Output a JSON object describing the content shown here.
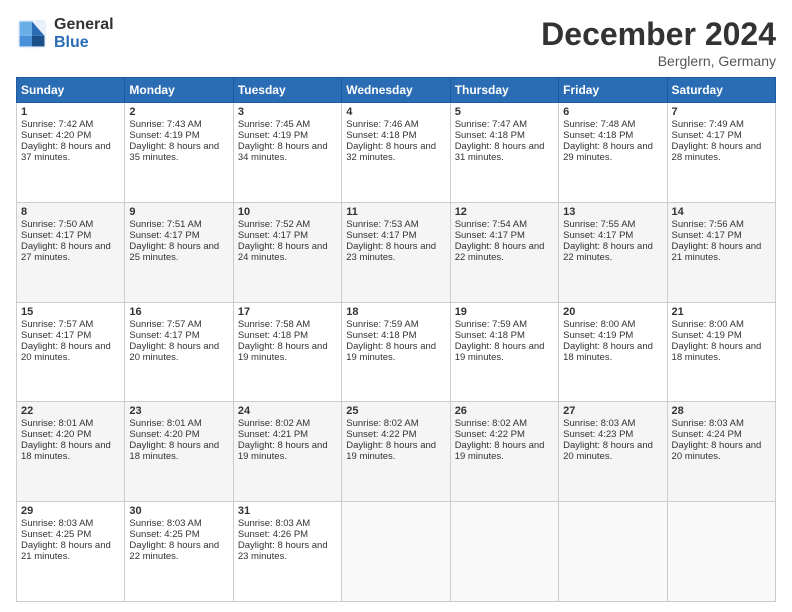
{
  "logo": {
    "general": "General",
    "blue": "Blue"
  },
  "header": {
    "month": "December 2024",
    "location": "Berglern, Germany"
  },
  "weekdays": [
    "Sunday",
    "Monday",
    "Tuesday",
    "Wednesday",
    "Thursday",
    "Friday",
    "Saturday"
  ],
  "weeks": [
    [
      {
        "day": "1",
        "sunrise": "Sunrise: 7:42 AM",
        "sunset": "Sunset: 4:20 PM",
        "daylight": "Daylight: 8 hours and 37 minutes."
      },
      {
        "day": "2",
        "sunrise": "Sunrise: 7:43 AM",
        "sunset": "Sunset: 4:19 PM",
        "daylight": "Daylight: 8 hours and 35 minutes."
      },
      {
        "day": "3",
        "sunrise": "Sunrise: 7:45 AM",
        "sunset": "Sunset: 4:19 PM",
        "daylight": "Daylight: 8 hours and 34 minutes."
      },
      {
        "day": "4",
        "sunrise": "Sunrise: 7:46 AM",
        "sunset": "Sunset: 4:18 PM",
        "daylight": "Daylight: 8 hours and 32 minutes."
      },
      {
        "day": "5",
        "sunrise": "Sunrise: 7:47 AM",
        "sunset": "Sunset: 4:18 PM",
        "daylight": "Daylight: 8 hours and 31 minutes."
      },
      {
        "day": "6",
        "sunrise": "Sunrise: 7:48 AM",
        "sunset": "Sunset: 4:18 PM",
        "daylight": "Daylight: 8 hours and 29 minutes."
      },
      {
        "day": "7",
        "sunrise": "Sunrise: 7:49 AM",
        "sunset": "Sunset: 4:17 PM",
        "daylight": "Daylight: 8 hours and 28 minutes."
      }
    ],
    [
      {
        "day": "8",
        "sunrise": "Sunrise: 7:50 AM",
        "sunset": "Sunset: 4:17 PM",
        "daylight": "Daylight: 8 hours and 27 minutes."
      },
      {
        "day": "9",
        "sunrise": "Sunrise: 7:51 AM",
        "sunset": "Sunset: 4:17 PM",
        "daylight": "Daylight: 8 hours and 25 minutes."
      },
      {
        "day": "10",
        "sunrise": "Sunrise: 7:52 AM",
        "sunset": "Sunset: 4:17 PM",
        "daylight": "Daylight: 8 hours and 24 minutes."
      },
      {
        "day": "11",
        "sunrise": "Sunrise: 7:53 AM",
        "sunset": "Sunset: 4:17 PM",
        "daylight": "Daylight: 8 hours and 23 minutes."
      },
      {
        "day": "12",
        "sunrise": "Sunrise: 7:54 AM",
        "sunset": "Sunset: 4:17 PM",
        "daylight": "Daylight: 8 hours and 22 minutes."
      },
      {
        "day": "13",
        "sunrise": "Sunrise: 7:55 AM",
        "sunset": "Sunset: 4:17 PM",
        "daylight": "Daylight: 8 hours and 22 minutes."
      },
      {
        "day": "14",
        "sunrise": "Sunrise: 7:56 AM",
        "sunset": "Sunset: 4:17 PM",
        "daylight": "Daylight: 8 hours and 21 minutes."
      }
    ],
    [
      {
        "day": "15",
        "sunrise": "Sunrise: 7:57 AM",
        "sunset": "Sunset: 4:17 PM",
        "daylight": "Daylight: 8 hours and 20 minutes."
      },
      {
        "day": "16",
        "sunrise": "Sunrise: 7:57 AM",
        "sunset": "Sunset: 4:17 PM",
        "daylight": "Daylight: 8 hours and 20 minutes."
      },
      {
        "day": "17",
        "sunrise": "Sunrise: 7:58 AM",
        "sunset": "Sunset: 4:18 PM",
        "daylight": "Daylight: 8 hours and 19 minutes."
      },
      {
        "day": "18",
        "sunrise": "Sunrise: 7:59 AM",
        "sunset": "Sunset: 4:18 PM",
        "daylight": "Daylight: 8 hours and 19 minutes."
      },
      {
        "day": "19",
        "sunrise": "Sunrise: 7:59 AM",
        "sunset": "Sunset: 4:18 PM",
        "daylight": "Daylight: 8 hours and 19 minutes."
      },
      {
        "day": "20",
        "sunrise": "Sunrise: 8:00 AM",
        "sunset": "Sunset: 4:19 PM",
        "daylight": "Daylight: 8 hours and 18 minutes."
      },
      {
        "day": "21",
        "sunrise": "Sunrise: 8:00 AM",
        "sunset": "Sunset: 4:19 PM",
        "daylight": "Daylight: 8 hours and 18 minutes."
      }
    ],
    [
      {
        "day": "22",
        "sunrise": "Sunrise: 8:01 AM",
        "sunset": "Sunset: 4:20 PM",
        "daylight": "Daylight: 8 hours and 18 minutes."
      },
      {
        "day": "23",
        "sunrise": "Sunrise: 8:01 AM",
        "sunset": "Sunset: 4:20 PM",
        "daylight": "Daylight: 8 hours and 18 minutes."
      },
      {
        "day": "24",
        "sunrise": "Sunrise: 8:02 AM",
        "sunset": "Sunset: 4:21 PM",
        "daylight": "Daylight: 8 hours and 19 minutes."
      },
      {
        "day": "25",
        "sunrise": "Sunrise: 8:02 AM",
        "sunset": "Sunset: 4:22 PM",
        "daylight": "Daylight: 8 hours and 19 minutes."
      },
      {
        "day": "26",
        "sunrise": "Sunrise: 8:02 AM",
        "sunset": "Sunset: 4:22 PM",
        "daylight": "Daylight: 8 hours and 19 minutes."
      },
      {
        "day": "27",
        "sunrise": "Sunrise: 8:03 AM",
        "sunset": "Sunset: 4:23 PM",
        "daylight": "Daylight: 8 hours and 20 minutes."
      },
      {
        "day": "28",
        "sunrise": "Sunrise: 8:03 AM",
        "sunset": "Sunset: 4:24 PM",
        "daylight": "Daylight: 8 hours and 20 minutes."
      }
    ],
    [
      {
        "day": "29",
        "sunrise": "Sunrise: 8:03 AM",
        "sunset": "Sunset: 4:25 PM",
        "daylight": "Daylight: 8 hours and 21 minutes."
      },
      {
        "day": "30",
        "sunrise": "Sunrise: 8:03 AM",
        "sunset": "Sunset: 4:25 PM",
        "daylight": "Daylight: 8 hours and 22 minutes."
      },
      {
        "day": "31",
        "sunrise": "Sunrise: 8:03 AM",
        "sunset": "Sunset: 4:26 PM",
        "daylight": "Daylight: 8 hours and 23 minutes."
      },
      null,
      null,
      null,
      null
    ]
  ]
}
